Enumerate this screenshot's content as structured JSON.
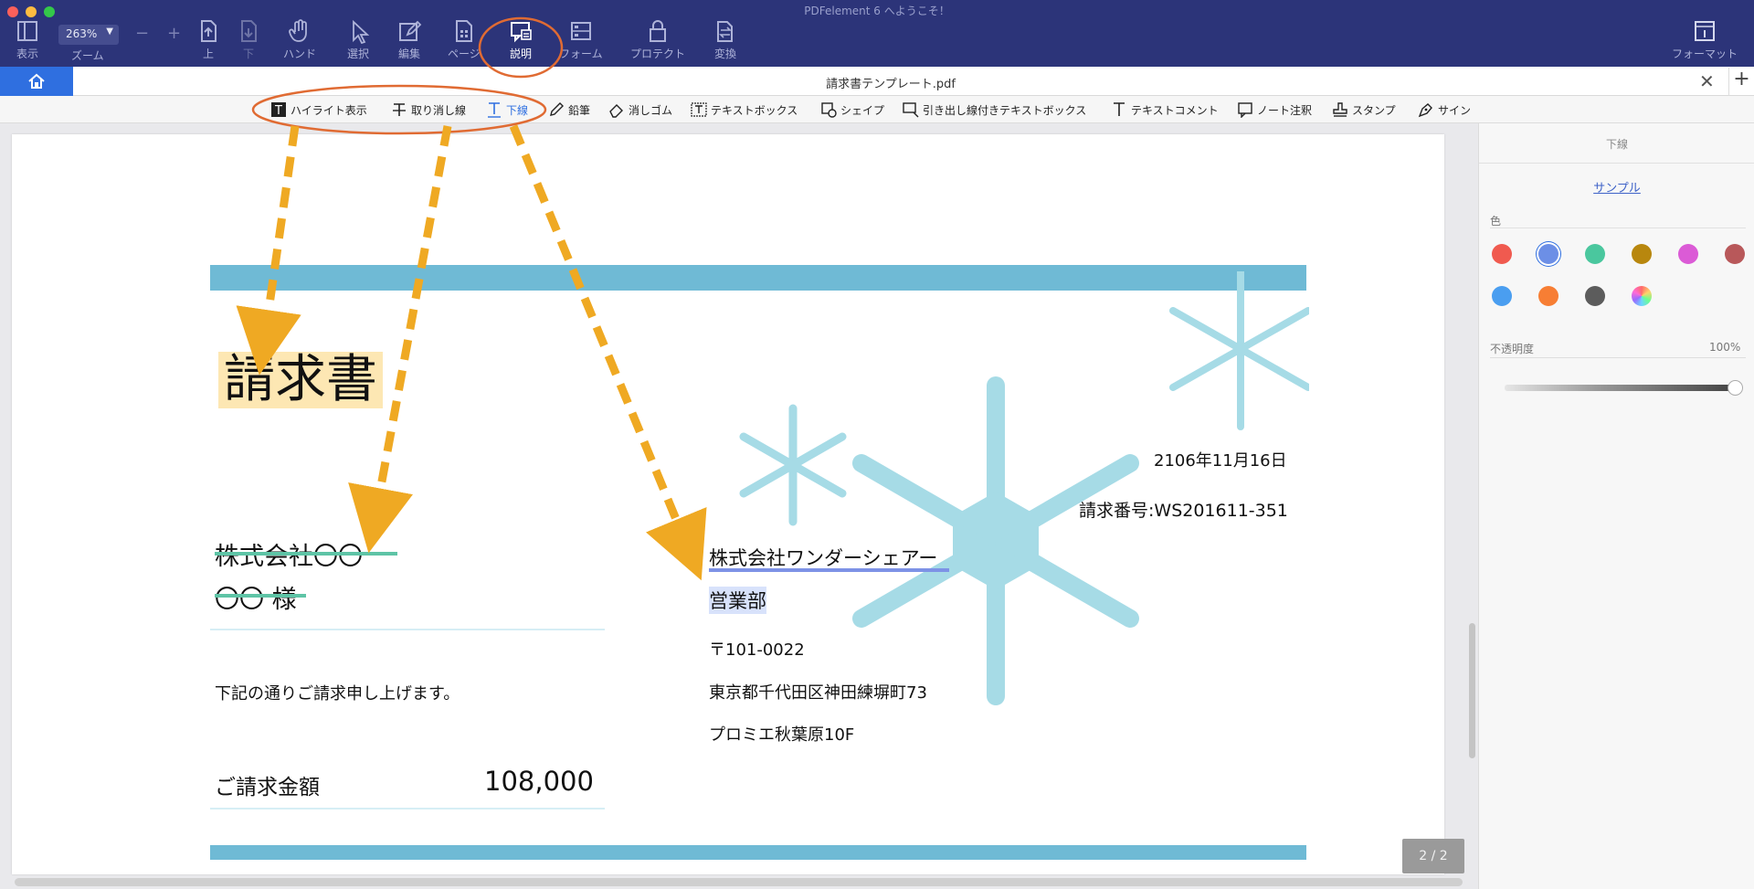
{
  "window": {
    "title": "PDFelement 6 へようこそ！"
  },
  "toolbar": {
    "view": "表示",
    "zoom_value": "263%",
    "zoom_label": "ズーム",
    "zoom_minus": "−",
    "zoom_plus": "+",
    "up": "上",
    "down": "下",
    "hand": "ハンド",
    "select": "選択",
    "edit": "編集",
    "page": "ページ",
    "comment": "説明",
    "form": "フォーム",
    "protect": "プロテクト",
    "convert": "変換",
    "format": "フォーマット"
  },
  "tab": {
    "filename": "請求書テンプレート.pdf",
    "close": "✕",
    "add": "+"
  },
  "annotation_tools": [
    {
      "label": "ハイライト表示"
    },
    {
      "label": "取り消し線"
    },
    {
      "label": "下線"
    },
    {
      "label": "鉛筆"
    },
    {
      "label": "消しゴム"
    },
    {
      "label": "テキストボックス"
    },
    {
      "label": "シェイプ"
    },
    {
      "label": "引き出し線付きテキストボックス"
    },
    {
      "label": "テキストコメント"
    },
    {
      "label": "ノート注釈"
    },
    {
      "label": "スタンプ"
    },
    {
      "label": "サイン"
    }
  ],
  "document": {
    "title": "請求書",
    "date": "2106年11月16日",
    "invoice_no": "請求番号:WS201611-351",
    "recipient_company": "株式会社〇〇",
    "recipient_name": "〇〇 様",
    "sender_company": "株式会社ワンダーシェアー",
    "sender_dept": "営業部",
    "postal": "〒101-0022",
    "address1": "東京都千代田区神田練塀町73",
    "address2": "プロミエ秋葉原10F",
    "message": "下記の通りご請求申し上げます。",
    "amount_label": "ご請求金額",
    "amount": "108,000"
  },
  "page_indicator": "2 / 2",
  "panel": {
    "title": "下線",
    "sample": "サンプル",
    "color_label": "色",
    "colors": [
      "#f05a4f",
      "#6c8fe6",
      "#4ac79e",
      "#b8870e",
      "#db5bd6",
      "#b8585a",
      "#4a9ef0",
      "#f77e34",
      "#5c5c5c",
      "rainbow"
    ],
    "selected_color": "#6c8fe6",
    "opacity_label": "不透明度",
    "opacity_value": "100%"
  },
  "accent_color": "#2f6fe0"
}
